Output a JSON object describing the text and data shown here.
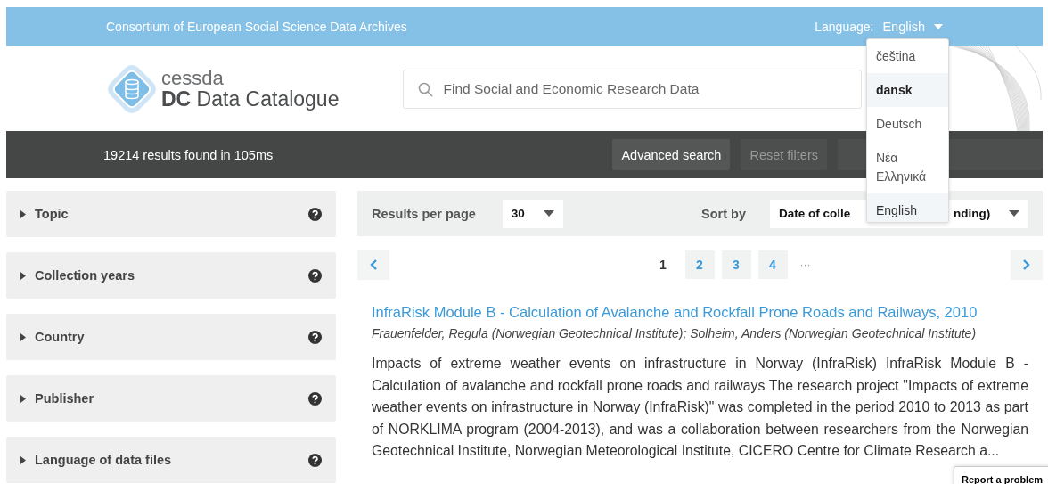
{
  "top_bar": {
    "title": "Consortium of European Social Science Data Archives",
    "language_label": "Language:",
    "language_value": "English"
  },
  "language_menu": [
    {
      "label": "čeština",
      "hovered": false,
      "selected": false
    },
    {
      "label": "dansk",
      "hovered": true,
      "selected": false
    },
    {
      "label": "Deutsch",
      "hovered": false,
      "selected": false
    },
    {
      "label": "Νέα Ελληνικά",
      "hovered": false,
      "selected": false
    },
    {
      "label": "English",
      "hovered": false,
      "selected": true
    }
  ],
  "logo": {
    "small": "cessda",
    "main": "**DC** Data Catalogue"
  },
  "search": {
    "placeholder": "Find Social and Economic Research Data"
  },
  "toolbar": {
    "summary": "19214 results found in 105ms",
    "buttons": [
      {
        "label": "Advanced search",
        "disabled": false
      },
      {
        "label": "Reset filters",
        "disabled": true
      }
    ]
  },
  "filters": [
    {
      "label": "Topic",
      "expanded": false
    },
    {
      "label": "Collection years",
      "expanded": false
    },
    {
      "label": "Country",
      "expanded": false
    },
    {
      "label": "Publisher",
      "expanded": false
    },
    {
      "label": "Language of data files",
      "expanded": false
    }
  ],
  "results_bar": {
    "per_page_label": "Results per page",
    "per_page_value": "30",
    "sort_label": "Sort by",
    "sort_value_parts": [
      "Date of colle",
      "nding)"
    ]
  },
  "pagination": {
    "pages": [
      {
        "label": "1",
        "selected": true
      },
      {
        "label": "2",
        "selected": false
      },
      {
        "label": "3",
        "selected": false
      },
      {
        "label": "4",
        "selected": false
      }
    ],
    "ellipsis": "···"
  },
  "results": [
    {
      "title": "InfraRisk Module B - Calculation of Avalanche and Rockfall Prone Roads and Railways, 2010",
      "authors": "Frauenfelder, Regula (Norwegian Geotechnical Institute); Solheim, Anders (Norwegian Geotechnical Institute)",
      "description": "Impacts of extreme weather events on infrastructure in Norway (InfraRisk) InfraRisk Module B - Calculation of avalanche and rockfall prone roads and railways The research project \"Impacts of extreme weather events on infrastructure in Norway (InfraRisk)\" was completed in the period 2010 to 2013 as part of NORKLIMA program (2004-2013), and was a collaboration between researchers from the Norwegian Geotechnical Institute, Norwegian Meteorological Institute, CICERO Centre for Climate Research a..."
    }
  ],
  "report_button": "Report a problem"
}
